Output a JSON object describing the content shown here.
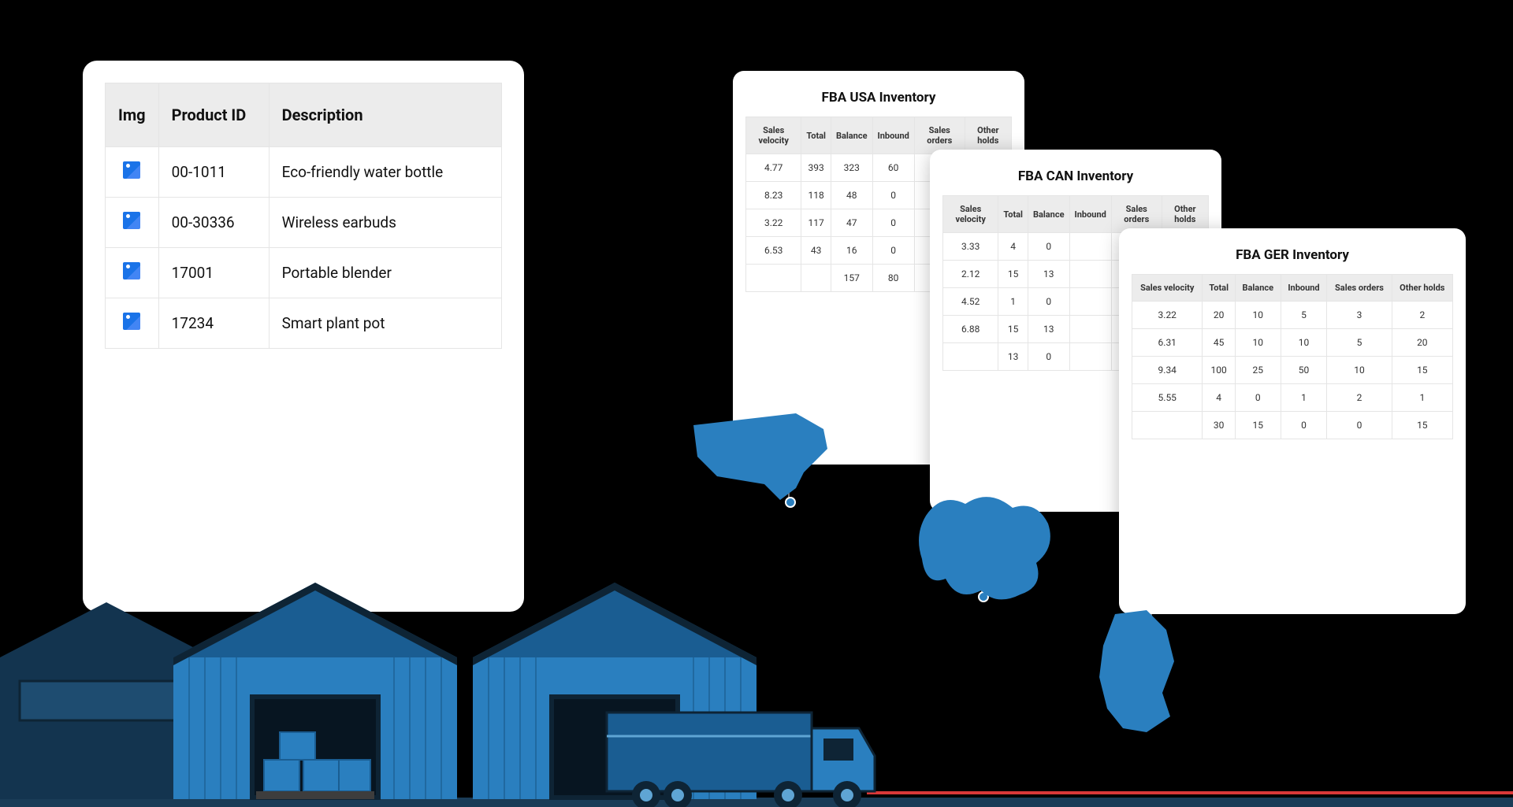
{
  "products": {
    "headers": {
      "img": "Img",
      "pid": "Product ID",
      "desc": "Description"
    },
    "rows": [
      {
        "pid": "00-1011",
        "desc": "Eco-friendly water bottle"
      },
      {
        "pid": "00-30336",
        "desc": "Wireless earbuds"
      },
      {
        "pid": "17001",
        "desc": "Portable blender"
      },
      {
        "pid": "17234",
        "desc": "Smart plant pot"
      }
    ]
  },
  "inventories": {
    "headers": {
      "sv": "Sales velocity",
      "total": "Total",
      "balance": "Balance",
      "inbound": "Inbound",
      "so": "Sales orders",
      "oh": "Other holds"
    },
    "usa": {
      "title": "FBA USA Inventory",
      "rows": [
        {
          "sv": "4.77",
          "total": "393",
          "balance": "323",
          "inbound": "60"
        },
        {
          "sv": "8.23",
          "total": "118",
          "balance": "48",
          "inbound": "0"
        },
        {
          "sv": "3.22",
          "total": "117",
          "balance": "47",
          "inbound": "0"
        },
        {
          "sv": "6.53",
          "total": "43",
          "balance": "16",
          "inbound": "0"
        },
        {
          "sv": "",
          "total": "",
          "balance": "157",
          "inbound": "80"
        }
      ]
    },
    "can": {
      "title": "FBA CAN Inventory",
      "rows": [
        {
          "sv": "3.33",
          "total": "4",
          "balance": "0"
        },
        {
          "sv": "2.12",
          "total": "15",
          "balance": "13"
        },
        {
          "sv": "4.52",
          "total": "1",
          "balance": "0"
        },
        {
          "sv": "6.88",
          "total": "15",
          "balance": "13"
        },
        {
          "sv": "",
          "total": "13",
          "balance": "0"
        }
      ]
    },
    "ger": {
      "title": "FBA GER Inventory",
      "rows": [
        {
          "sv": "3.22",
          "total": "20",
          "balance": "10",
          "inbound": "5",
          "so": "3",
          "oh": "2"
        },
        {
          "sv": "6.31",
          "total": "45",
          "balance": "10",
          "inbound": "10",
          "so": "5",
          "oh": "20"
        },
        {
          "sv": "9.34",
          "total": "100",
          "balance": "25",
          "inbound": "50",
          "so": "10",
          "oh": "15"
        },
        {
          "sv": "5.55",
          "total": "4",
          "balance": "0",
          "inbound": "1",
          "so": "2",
          "oh": "1"
        },
        {
          "sv": "",
          "total": "30",
          "balance": "15",
          "inbound": "0",
          "so": "0",
          "oh": "15"
        }
      ]
    }
  }
}
